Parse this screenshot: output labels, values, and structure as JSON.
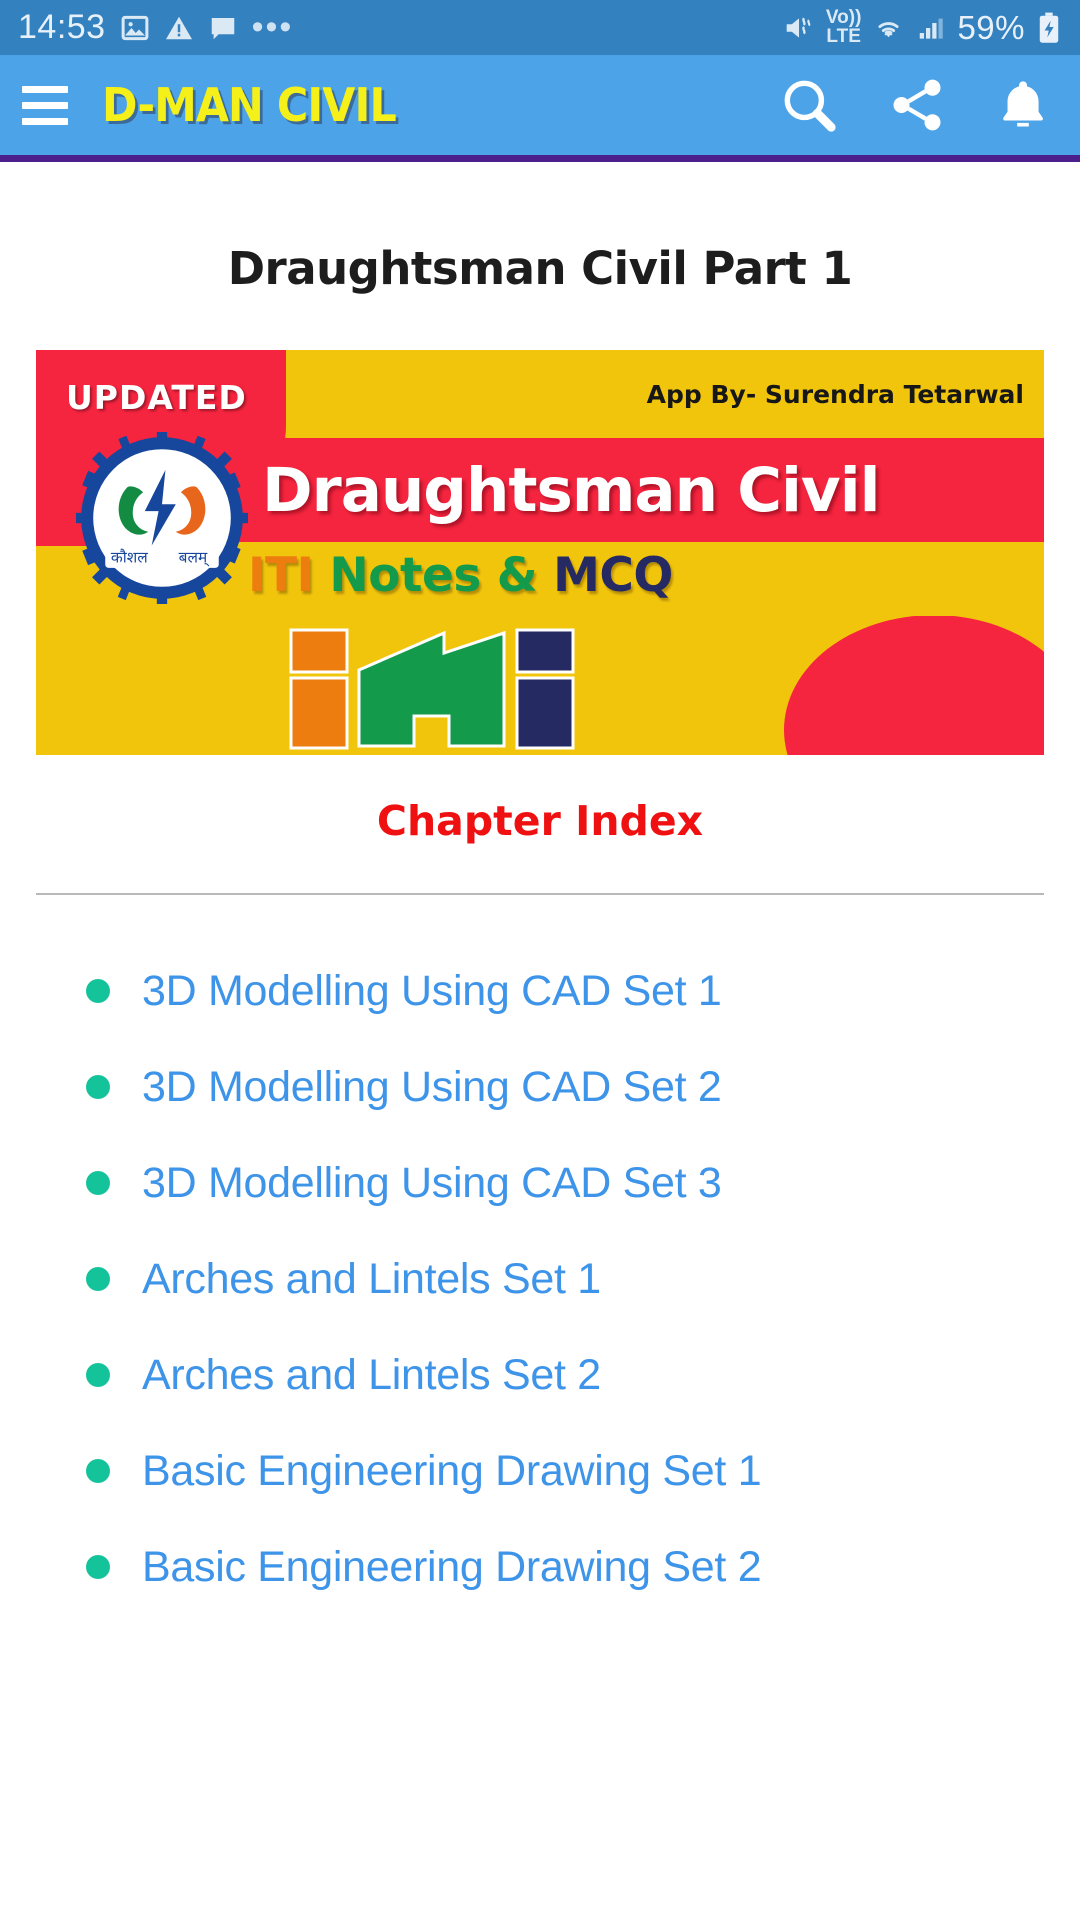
{
  "status_bar": {
    "time": "14:53",
    "battery_percent": "59%",
    "icons": [
      "image-icon",
      "warning-icon",
      "message-icon",
      "overflow-dots-icon",
      "mute-vibrate-icon",
      "volte-icon",
      "wifi-icon",
      "signal-icon",
      "battery-charging-icon"
    ],
    "volte_top": "Vo))",
    "volte_bottom": "LTE",
    "background_color": "#3481c0"
  },
  "app_bar": {
    "brand": "D-MAN CIVIL",
    "menu_icon": "hamburger-icon",
    "actions": [
      {
        "name": "search-icon",
        "label": "Search"
      },
      {
        "name": "share-icon",
        "label": "Share"
      },
      {
        "name": "notification-bell-icon",
        "label": "Notifications"
      }
    ],
    "background_color": "#4da3e8",
    "brand_color": "#f5f019",
    "accent_rule_color": "#4b1f8c"
  },
  "main": {
    "page_title": "Draughtsman Civil Part 1",
    "banner": {
      "updated_badge": "UPDATED",
      "app_by": "App By- Surendra Tetarwal",
      "title": "Draughtsman Civil",
      "subtitle_parts": [
        {
          "text": "ITI",
          "color": "#ee7d10"
        },
        {
          "text": "Notes &",
          "color": "#139a4a"
        },
        {
          "text": "MCQ",
          "color": "#262a63"
        }
      ],
      "emblem_text_left": "कौशल",
      "emblem_text_right": "बलम्",
      "logo_name": "iti-logo",
      "background_color": "#f2c50d",
      "accent_color": "#f5243f"
    },
    "chapter_index_heading": "Chapter Index",
    "chapters": [
      {
        "label": "3D Modelling Using CAD Set 1"
      },
      {
        "label": "3D Modelling Using CAD Set 2"
      },
      {
        "label": "3D Modelling Using CAD Set 3"
      },
      {
        "label": "Arches and Lintels Set 1"
      },
      {
        "label": "Arches and Lintels Set 2"
      },
      {
        "label": "Basic Engineering Drawing Set 1"
      },
      {
        "label": "Basic Engineering Drawing Set 2"
      }
    ],
    "link_color": "#3d94e8",
    "bullet_color": "#14c39a"
  }
}
